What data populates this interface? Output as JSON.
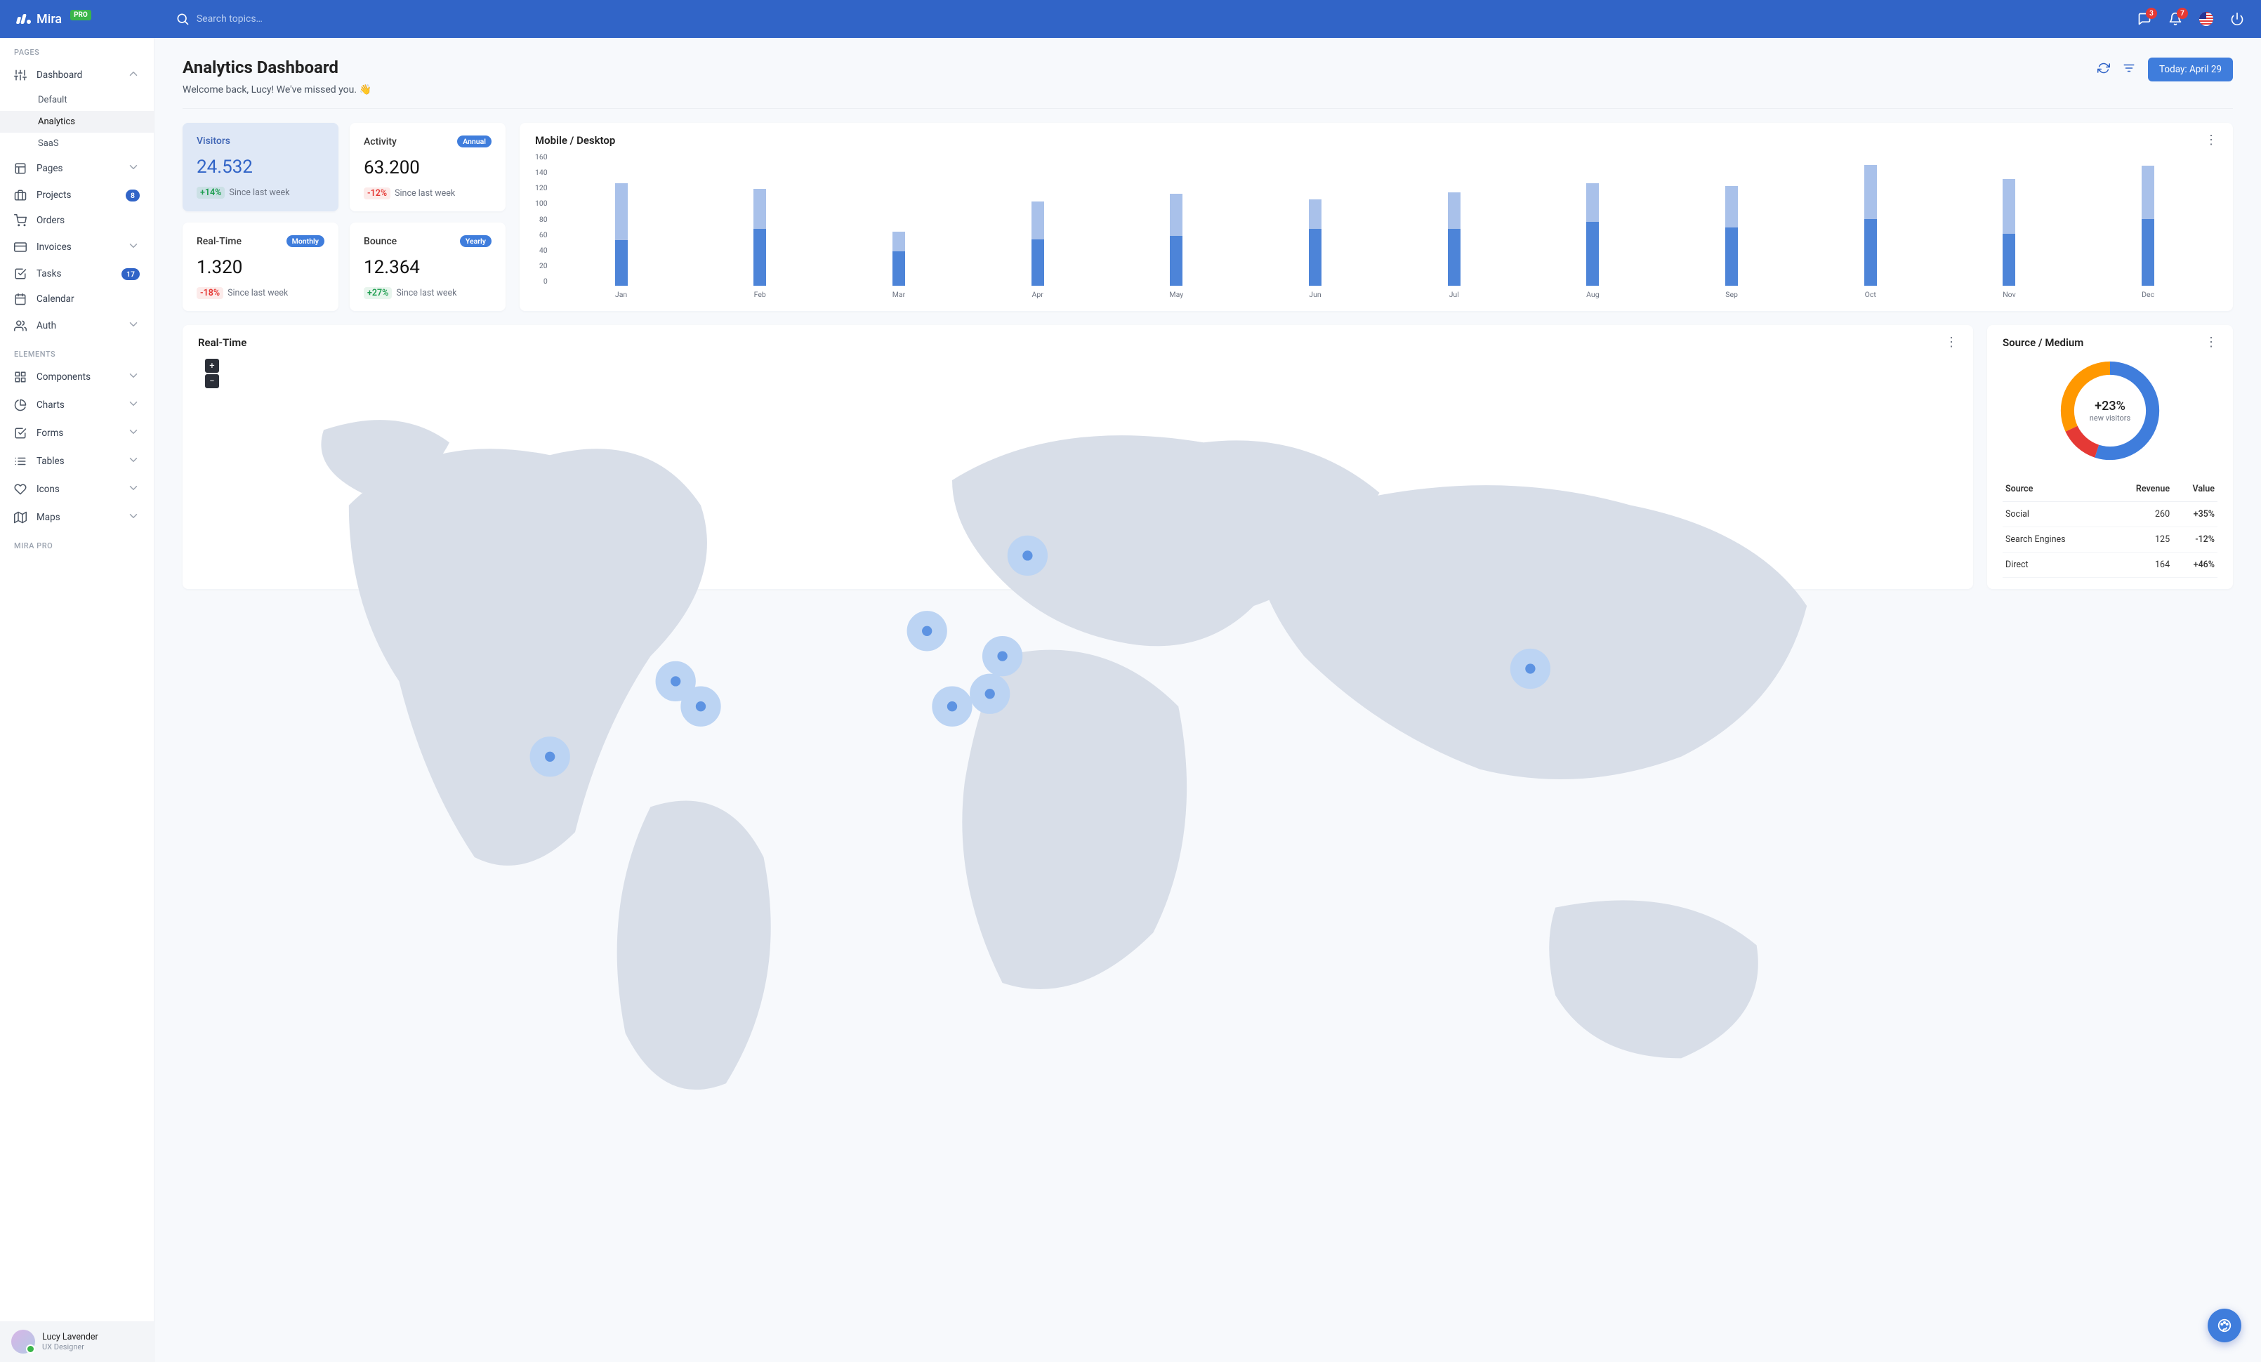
{
  "brand": {
    "name": "Mira",
    "badge": "PRO"
  },
  "topbar": {
    "search_placeholder": "Search topics…",
    "msg_badge": "3",
    "notif_badge": "7"
  },
  "sidebar": {
    "section_pages": "PAGES",
    "section_elements": "ELEMENTS",
    "section_pro": "MIRA PRO",
    "dashboard": {
      "label": "Dashboard",
      "children": {
        "default": "Default",
        "analytics": "Analytics",
        "saas": "SaaS"
      }
    },
    "pages": {
      "label": "Pages"
    },
    "projects": {
      "label": "Projects",
      "badge": "8"
    },
    "orders": {
      "label": "Orders"
    },
    "invoices": {
      "label": "Invoices"
    },
    "tasks": {
      "label": "Tasks",
      "badge": "17"
    },
    "calendar": {
      "label": "Calendar"
    },
    "auth": {
      "label": "Auth"
    },
    "components": {
      "label": "Components"
    },
    "charts": {
      "label": "Charts"
    },
    "forms": {
      "label": "Forms"
    },
    "tables": {
      "label": "Tables"
    },
    "icons": {
      "label": "Icons"
    },
    "maps": {
      "label": "Maps"
    },
    "user": {
      "name": "Lucy Lavender",
      "role": "UX Designer"
    }
  },
  "page": {
    "title": "Analytics Dashboard",
    "subtitle": "Welcome back, Lucy! We've missed you. 👋",
    "date_button": "Today: April 29"
  },
  "stats": {
    "visitors": {
      "label": "Visitors",
      "value": "24.532",
      "change": "+14%",
      "since": "Since last week",
      "dir": "pos"
    },
    "activity": {
      "label": "Activity",
      "tag": "Annual",
      "value": "63.200",
      "change": "-12%",
      "since": "Since last week",
      "dir": "neg"
    },
    "realtime": {
      "label": "Real-Time",
      "tag": "Monthly",
      "value": "1.320",
      "change": "-18%",
      "since": "Since last week",
      "dir": "neg"
    },
    "bounce": {
      "label": "Bounce",
      "tag": "Yearly",
      "value": "12.364",
      "change": "+27%",
      "since": "Since last week",
      "dir": "pos"
    }
  },
  "chart_data": {
    "type": "bar",
    "title": "Mobile / Desktop",
    "categories": [
      "Jan",
      "Feb",
      "Mar",
      "Apr",
      "May",
      "Jun",
      "Jul",
      "Aug",
      "Sep",
      "Oct",
      "Nov",
      "Dec"
    ],
    "series": [
      {
        "name": "Mobile",
        "values": [
          55,
          68,
          41,
          56,
          60,
          68,
          68,
          77,
          70,
          80,
          62,
          80
        ]
      },
      {
        "name": "Desktop",
        "values": [
          68,
          48,
          24,
          45,
          50,
          36,
          44,
          46,
          50,
          65,
          66,
          64
        ]
      }
    ],
    "ylabel": "",
    "xlabel": "",
    "ylim": [
      0,
      160
    ],
    "y_ticks": [
      "160",
      "140",
      "120",
      "100",
      "80",
      "60",
      "40",
      "20",
      "0"
    ]
  },
  "map": {
    "title": "Real-Time",
    "zoom_in": "+",
    "zoom_out": "−"
  },
  "source": {
    "title": "Source / Medium",
    "center_pct": "+23%",
    "center_lbl": "new visitors",
    "headers": {
      "source": "Source",
      "revenue": "Revenue",
      "value": "Value"
    },
    "rows": [
      {
        "source": "Social",
        "revenue": "260",
        "value": "+35%",
        "dir": "pos"
      },
      {
        "source": "Search Engines",
        "revenue": "125",
        "value": "-12%",
        "dir": "neg"
      },
      {
        "source": "Direct",
        "revenue": "164",
        "value": "+46%",
        "dir": "pos"
      }
    ],
    "donut_segments": [
      {
        "name": "blue",
        "color": "#3f7ddc",
        "pct": 55
      },
      {
        "name": "red",
        "color": "#e53935",
        "pct": 13
      },
      {
        "name": "orange",
        "color": "#ff9800",
        "pct": 32
      }
    ]
  }
}
